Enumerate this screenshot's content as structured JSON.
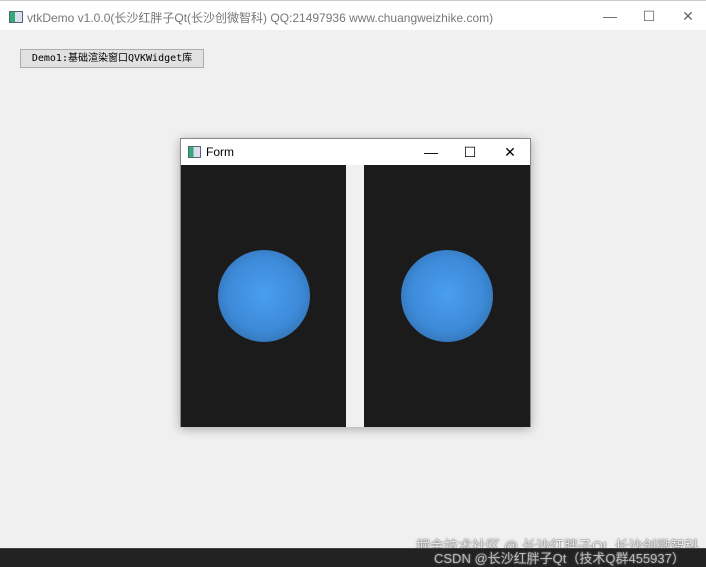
{
  "main_window": {
    "title": "vtkDemo v1.0.0(长沙红胖子Qt(长沙创微智科) QQ:21497936 www.chuangweizhike.com)",
    "minimize": "—",
    "maximize": "☐",
    "close": "✕"
  },
  "demo_button": "Demo1:基础渲染窗口QVKWidget库",
  "form": {
    "title": "Form",
    "minimize": "—",
    "maximize": "☐",
    "close": "✕"
  },
  "watermarks": {
    "juejin": "掘金技术社区 @ 长沙红胖子Qt_长沙创微智科",
    "csdn": "CSDN @长沙红胖子Qt（技术Q群455937）"
  },
  "colors": {
    "sphere": "#3d8ad8",
    "render_bg": "#1b1b1b"
  }
}
